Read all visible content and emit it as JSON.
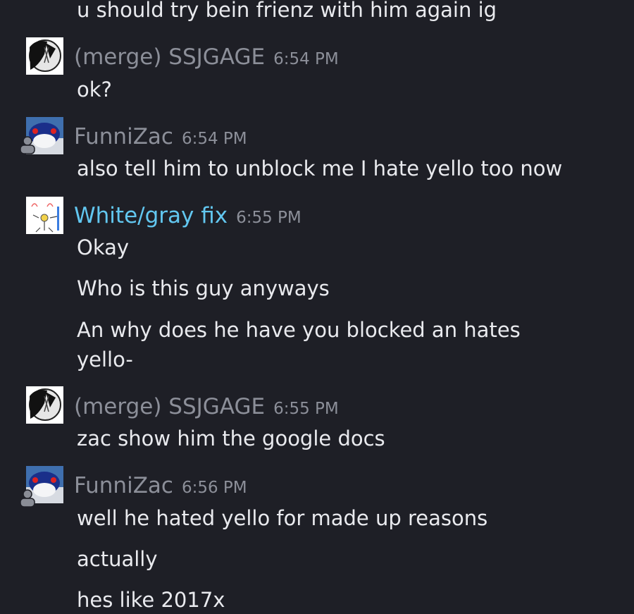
{
  "messages": {
    "m0": "u should try bein frienz with him again ig",
    "g1": {
      "author": "(merge) SSJGAGE",
      "time": "6:54 PM",
      "lines": [
        "ok?"
      ]
    },
    "g2": {
      "author": "FunniZac",
      "time": "6:54 PM",
      "lines": [
        "also tell him to unblock me I hate yello too now"
      ]
    },
    "g3": {
      "author": "White/gray fix",
      "time": "6:55 PM",
      "lines": [
        "Okay",
        "Who is this guy anyways",
        "An why does he have you blocked an hates yello-"
      ]
    },
    "g4": {
      "author": "(merge) SSJGAGE",
      "time": "6:55 PM",
      "lines": [
        "zac show him the google docs"
      ]
    },
    "g5": {
      "author": "FunniZac",
      "time": "6:56 PM",
      "lines": [
        "well he hated yello for made up reasons",
        "actually",
        "hes like 2017x"
      ]
    }
  },
  "colors": {
    "background": "#1e1f26",
    "text": "#e9eaee",
    "muted_name": "#8c8f99",
    "highlight_name": "#62c7f0"
  },
  "icons": {
    "ssjgage_avatar": "black-white-drawing-avatar",
    "funnizac_avatar": "blue-creature-avatar",
    "whitegray_avatar": "sketch-drawing-avatar",
    "status": "offline-person-icon"
  }
}
